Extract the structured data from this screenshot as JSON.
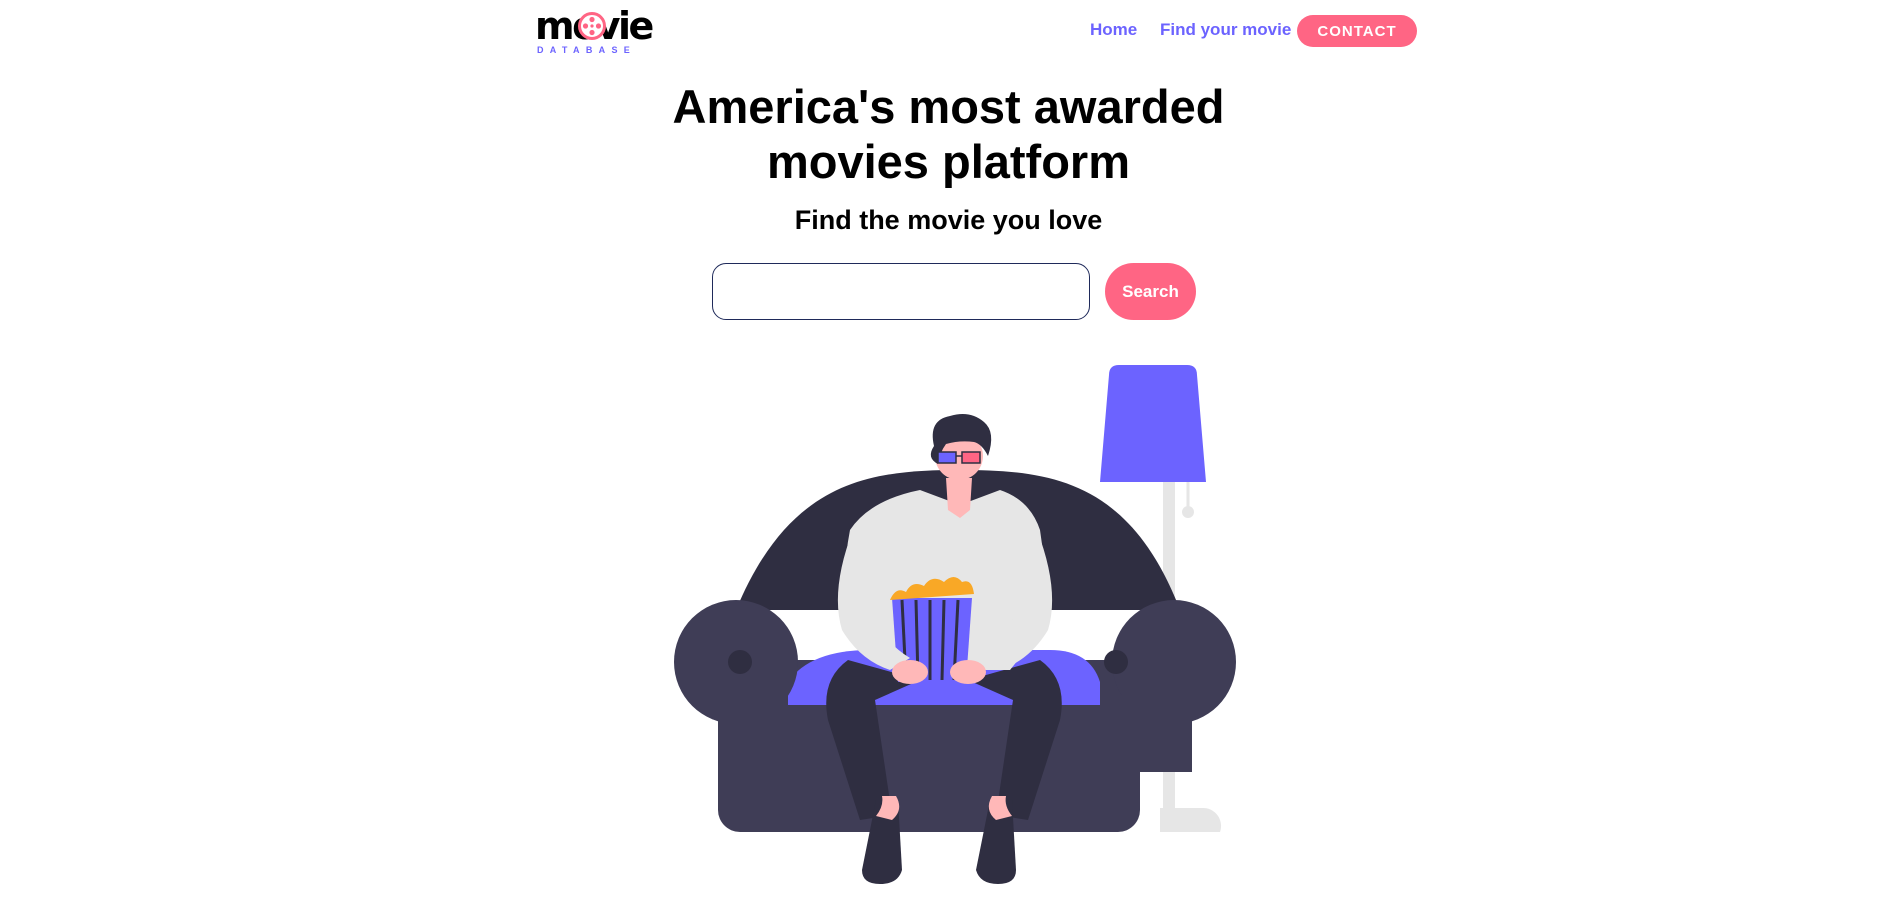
{
  "header": {
    "logo": {
      "word": "movie",
      "sub": "DATABASE"
    },
    "nav": {
      "home": "Home",
      "find": "Find your movie",
      "contact": "CONTACT"
    }
  },
  "hero": {
    "title_line1": "America's most awarded",
    "title_line2": "movies platform",
    "subtitle": "Find the movie you love",
    "search": {
      "value": "",
      "placeholder": "",
      "button": "Search"
    }
  },
  "illustration": {
    "icon": "person-watching-movie-illustration",
    "colors": {
      "sofa": "#3f3d56",
      "sofa_back": "#2f2e41",
      "cushion": "#6c63ff",
      "lamp_shade": "#6c63ff",
      "lamp_pole": "#e6e6e6",
      "shirt": "#e6e6e6",
      "pants": "#2f2e41",
      "skin": "#ffb8b8",
      "popcorn": "#f9a826",
      "glasses_left": "#6c63ff",
      "glasses_right": "#ff6584"
    }
  },
  "colors": {
    "accent": "#6c63ff",
    "brand_pink": "#ff6584",
    "text": "#000000",
    "input_border": "#1f2a5a"
  }
}
